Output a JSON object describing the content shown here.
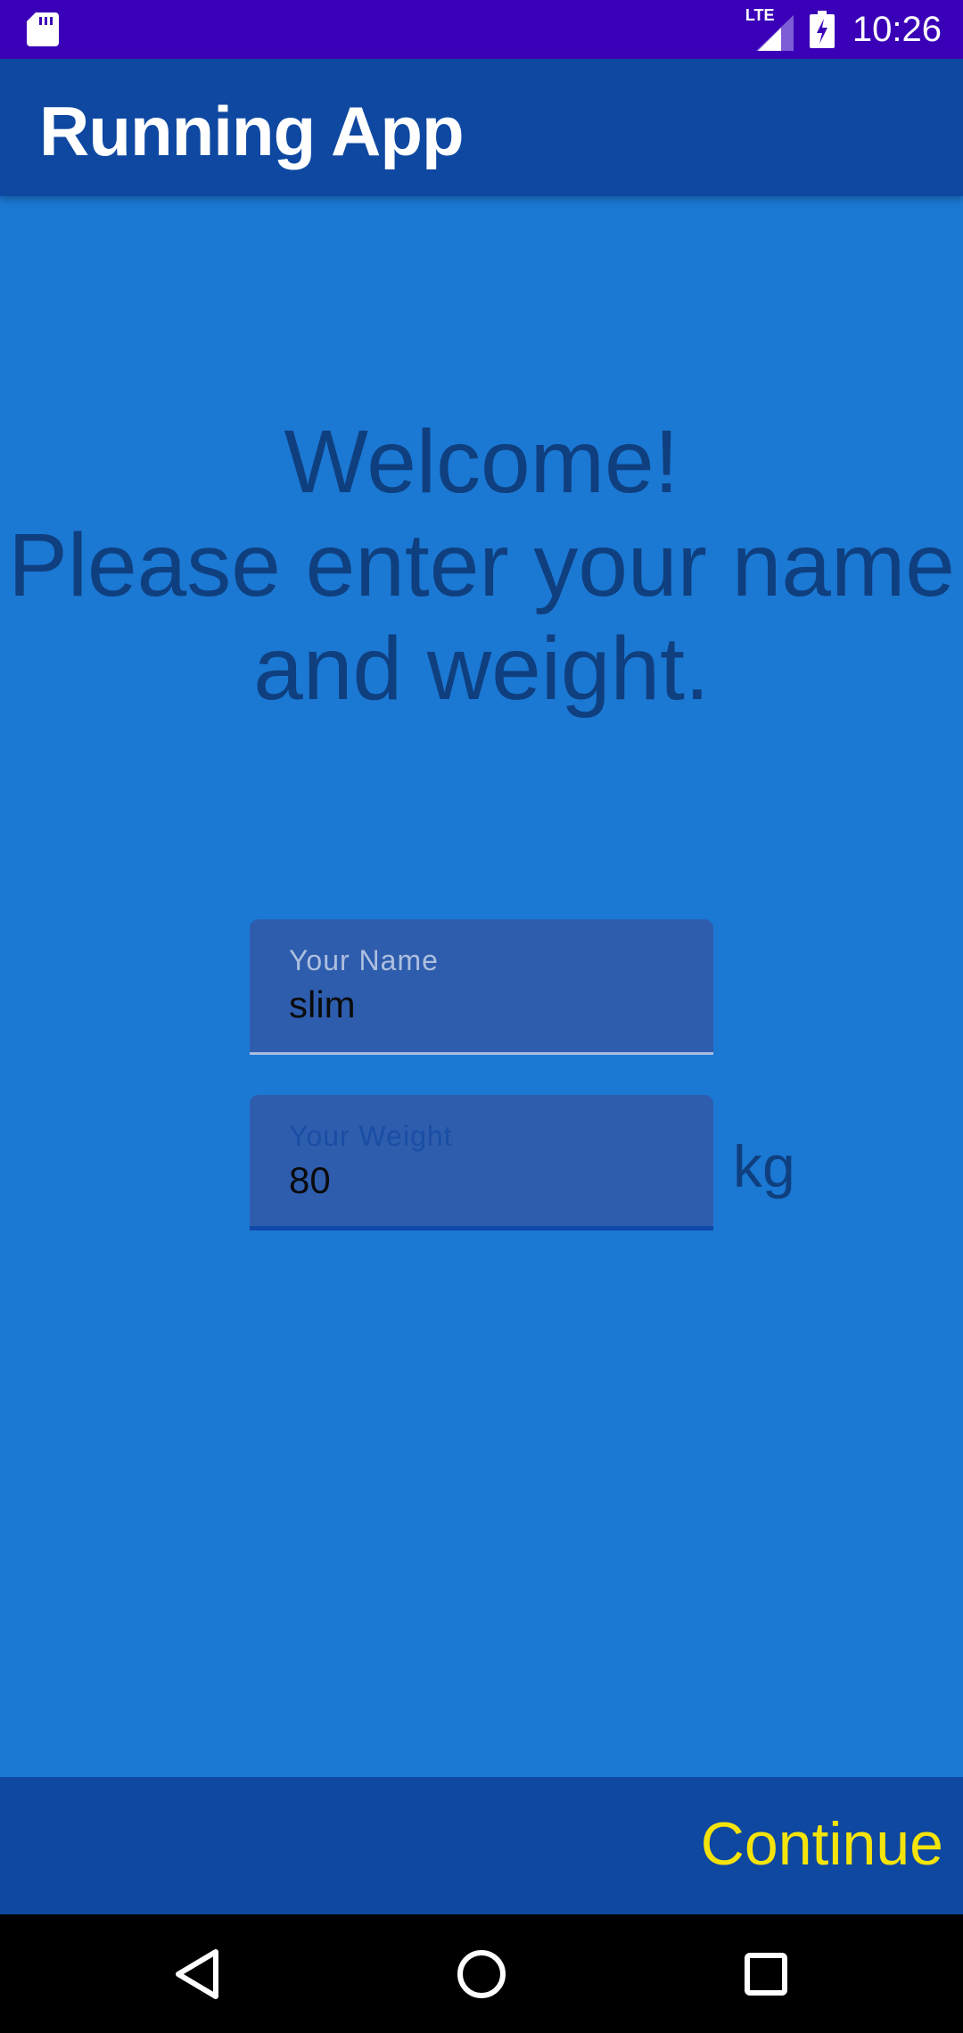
{
  "status_bar": {
    "time": "10:26",
    "network": "LTE",
    "icons": [
      "sd-card-icon",
      "signal-icon",
      "battery-charging-icon"
    ]
  },
  "app_bar": {
    "title": "Running App"
  },
  "welcome": {
    "line1": "Welcome!",
    "line2": "Please enter your name",
    "line3": "and weight."
  },
  "form": {
    "name_label": "Your Name",
    "name_value": "slim",
    "weight_label": "Your Weight",
    "weight_value": "80",
    "weight_unit": "kg"
  },
  "bottom_bar": {
    "continue_label": "Continue"
  },
  "nav_bar": {
    "buttons": [
      "back-icon",
      "home-icon",
      "recents-icon"
    ]
  },
  "colors": {
    "background": "#1b78d3",
    "app_bar": "#0e48a1",
    "status_bar": "#3a00b7",
    "accent_text": "#f5e40a",
    "heading_text": "#0f3f7e"
  }
}
